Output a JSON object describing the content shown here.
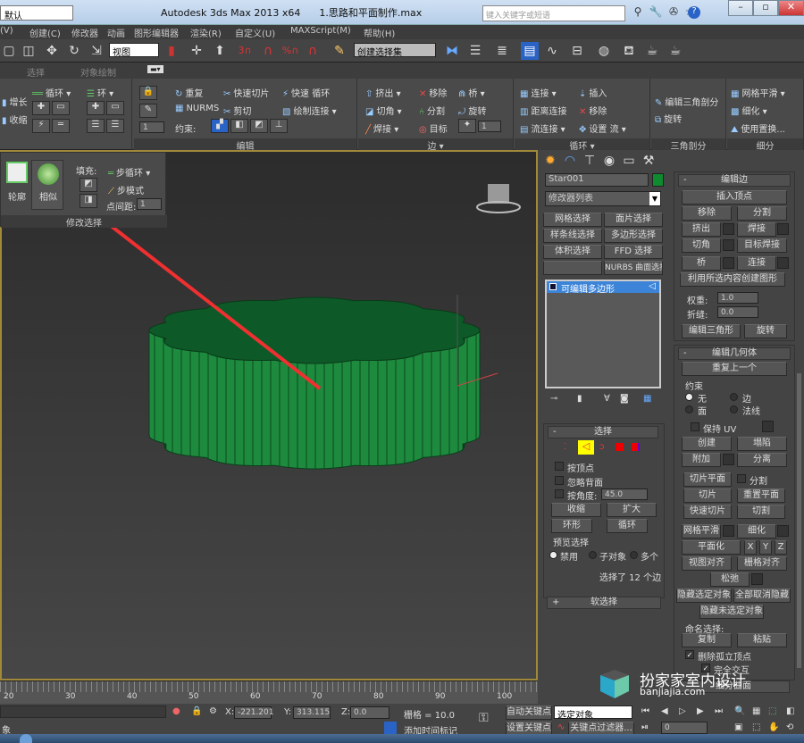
{
  "title": {
    "workspace": "默认",
    "app": "Autodesk 3ds Max  2013 x64",
    "file": "1.思路和平面制作.max",
    "search_placeholder": "键入关键字或短语"
  },
  "menu": [
    "(V)",
    "创建(C)",
    "修改器",
    "动画",
    "图形编辑器",
    "渲染(R)",
    "自定义(U)",
    "MAXScript(M)",
    "帮助(H)"
  ],
  "toolbar": {
    "view_dropdown": "视图",
    "selset_dropdown": "创建选择集",
    "snap_3": "3",
    "snap_pct": "%"
  },
  "ribbon_tabs": [
    "选择",
    "对象绘制"
  ],
  "ribbon": {
    "g1": {
      "grow": "增长",
      "shrink": "收缩",
      "loop": "循环",
      "ring": "环"
    },
    "edit": {
      "label": "编辑",
      "repeat": "重复",
      "quickslice": "快速切片",
      "quickloop": "快速 循环",
      "nurms": "NURMS",
      "cut": "剪切",
      "paintconnect": "绘制连接",
      "constraint": "约束:",
      "spin": "1"
    },
    "edges": {
      "label": "边",
      "extrude": "挤出",
      "remove": "移除",
      "bridge": "桥",
      "chamfer": "切角",
      "split": "分割",
      "spin": "旋转",
      "weld": "焊接",
      "target": "目标",
      "num": "1"
    },
    "loops": {
      "label": "循环",
      "connect": "连接",
      "distconnect": "距离连接",
      "flowconnect": "流连接",
      "insert": "插入",
      "remove": "移除",
      "setflow": "设置 流"
    },
    "tri": {
      "label": "三角剖分",
      "edittri": "编辑三角剖分",
      "turn": "旋转"
    },
    "subdiv": {
      "label": "细分",
      "meshsmooth": "网格平滑",
      "tessellate": "细化",
      "usedisp": "使用置换..."
    }
  },
  "float_panel": {
    "outline": "轮廓",
    "similar": "相似",
    "fill": "填充:",
    "steploop": "步循环",
    "stepmode": "步模式",
    "pointgap": "点间距:",
    "pointgap_value": "1",
    "label": "修改选择"
  },
  "command": {
    "object_name": "Star001",
    "object_color": "#0f8a2e",
    "modifier_list": "修改器列表",
    "mod_buttons": [
      "网格选择",
      "面片选择",
      "样条线选择",
      "多边形选择",
      "体积选择",
      "FFD 选择",
      "",
      "NURBS 曲面选择"
    ],
    "stack_item": "可编辑多边形",
    "selection": {
      "title": "选择",
      "by_vertex": "按顶点",
      "ignore_back": "忽略背面",
      "by_angle": "按角度:",
      "angle": "45.0",
      "shrink": "收缩",
      "grow": "扩大",
      "ring": "环形",
      "loop": "循环",
      "preview": "预览选择",
      "off": "禁用",
      "subobj": "子对象",
      "multi": "多个",
      "status": "选择了 12 个边"
    },
    "soft": "软选择",
    "edit_edges": {
      "title": "编辑边",
      "insert_vertex": "插入顶点",
      "remove": "移除",
      "split": "分割",
      "extrude": "挤出",
      "weld": "焊接",
      "chamfer": "切角",
      "target_weld": "目标焊接",
      "bridge": "桥",
      "connect": "连接",
      "create_shape": "利用所选内容创建图形",
      "weight": "权重:",
      "weight_v": "1.0",
      "crease": "折缝:",
      "crease_v": "0.0",
      "edit_tri": "编辑三角形",
      "turn": "旋转"
    },
    "edit_geom": {
      "title": "编辑几何体",
      "repeat": "重复上一个",
      "constraints": "约束",
      "none": "无",
      "edge": "边",
      "face": "面",
      "normal": "法线",
      "preserve_uv": "保持 UV",
      "create": "创建",
      "collapse": "塌陷",
      "attach": "附加",
      "detach": "分离",
      "slice_plane": "切片平面",
      "split": "分割",
      "slice": "切片",
      "reset_plane": "重置平面",
      "quickslice": "快速切片",
      "cut": "切割",
      "meshsmooth": "网格平滑",
      "tessellate": "细化",
      "make_planar": "平面化",
      "x": "X",
      "y": "Y",
      "z": "Z",
      "view_align": "视图对齐",
      "grid_align": "栅格对齐",
      "relax": "松弛",
      "hide_sel": "隐藏选定对象",
      "unhide_all": "全部取消隐藏",
      "hide_unsel": "隐藏未选定对象",
      "named_sel": "命名选择:",
      "copy": "复制",
      "paste": "粘贴",
      "delete_iso": "删除孤立顶点",
      "full_interact": "完全交互",
      "subdiv_surface": "细分曲面"
    }
  },
  "timeline": {
    "ticks": [
      "20",
      "30",
      "40",
      "50",
      "60",
      "70",
      "80",
      "90",
      "100"
    ]
  },
  "status": {
    "x_label": "X:",
    "x": "-221.201",
    "y_label": "Y:",
    "y": "313.115",
    "z_label": "Z:",
    "z": "0.0",
    "grid": "栅格 = 10.0",
    "add_time_tag": "添加时间标记",
    "autokey": "自动关键点",
    "setkey": "设置关键点",
    "key_target": "选定对象",
    "key_filters": "关键点过滤器...",
    "frame": "0",
    "prompt": "象"
  },
  "watermark": {
    "name": "扮家家室内设计",
    "url": "banjiajia.com"
  }
}
